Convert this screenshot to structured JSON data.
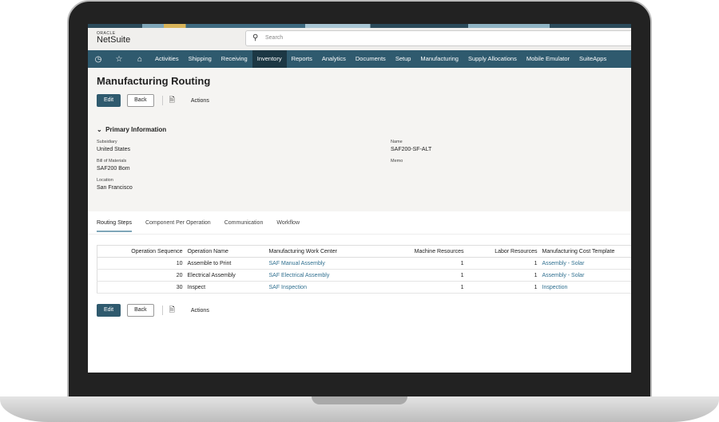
{
  "app": {
    "oracle": "ORACLE",
    "name": "NetSuite"
  },
  "search": {
    "placeholder": "Search"
  },
  "nav": [
    "Activities",
    "Shipping",
    "Receiving",
    "Inventory",
    "Reports",
    "Analytics",
    "Documents",
    "Setup",
    "Manufacturing",
    "Supply Allocations",
    "Mobile Emulator",
    "SuiteApps"
  ],
  "page": {
    "title": "Manufacturing Routing",
    "edit": "Edit",
    "back": "Back",
    "actions": "Actions"
  },
  "primary": {
    "section": "Primary Information",
    "subsidiary_label": "Subsidiary",
    "subsidiary": "United States",
    "bom_label": "Bill of Materials",
    "bom": "SAF200 Bom",
    "location_label": "Location",
    "location": "San Francisco",
    "name_label": "Name",
    "name": "SAF200-SF-ALT",
    "memo_label": "Memo"
  },
  "tabs": [
    "Routing Steps",
    "Component Per Operation",
    "Communication",
    "Workflow"
  ],
  "table": {
    "headers": [
      "Operation Sequence",
      "Operation Name",
      "Manufacturing Work Center",
      "Machine Resources",
      "Labor Resources",
      "Manufacturing Cost Template"
    ],
    "rows": [
      [
        "10",
        "Assemble to Print",
        "SAF Manual Assembly",
        "1",
        "1",
        "Assembly - Solar"
      ],
      [
        "20",
        "Electrical Assembly",
        "SAF Electrical Assembly",
        "1",
        "1",
        "Assembly - Solar"
      ],
      [
        "30",
        "Inspect",
        "SAF Inspection",
        "1",
        "1",
        "Inspection"
      ]
    ]
  }
}
